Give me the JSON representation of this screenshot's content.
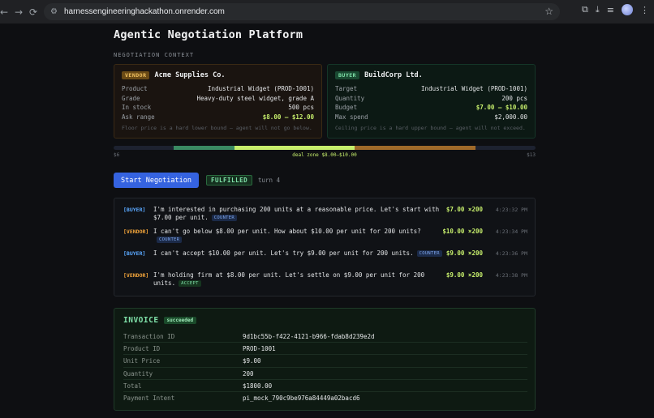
{
  "browser": {
    "url": "harnessengineeringhackathon.onrender.com"
  },
  "page": {
    "title": "Agentic Negotiation Platform",
    "section_label": "NEGOTIATION CONTEXT"
  },
  "vendor": {
    "tag": "VENDOR",
    "name": "Acme Supplies Co.",
    "rows": [
      {
        "k": "Product",
        "v": "Industrial Widget (PROD-1001)"
      },
      {
        "k": "Grade",
        "v": "Heavy-duty steel widget, grade A"
      },
      {
        "k": "In stock",
        "v": "500 pcs"
      },
      {
        "k": "Ask range",
        "v": "$8.00 – $12.00"
      }
    ],
    "note": "Floor price is a hard lower bound — agent will not go below."
  },
  "buyer": {
    "tag": "BUYER",
    "name": "BuildCorp Ltd.",
    "rows": [
      {
        "k": "Target",
        "v": "Industrial Widget (PROD-1001)"
      },
      {
        "k": "Quantity",
        "v": "200 pcs"
      },
      {
        "k": "Budget",
        "v": "$7.00 – $10.00"
      },
      {
        "k": "Max spend",
        "v": "$2,000.00"
      }
    ],
    "note": "Ceiling price is a hard upper bound — agent will not exceed."
  },
  "range": {
    "min_label": "$6",
    "max_label": "$13",
    "zone_label": "deal zone $8.00–$10.00",
    "min": 6,
    "max": 13,
    "buyer_range": [
      7,
      10
    ],
    "vendor_range": [
      8,
      12
    ],
    "zone": [
      8,
      10
    ],
    "colors": {
      "buyer": "#3a8a62",
      "zone": "#c6ee6c",
      "vendor": "#a06a2a"
    }
  },
  "controls": {
    "start_label": "Start Negotiation",
    "status": "FULFILLED",
    "turn": "turn 4"
  },
  "transcript": [
    {
      "role": "[BUYER]",
      "side": "buyer",
      "text": "I'm interested in purchasing 200 units at a reasonable price. Let's start with $7.00 per unit.",
      "badge": "COUNTER",
      "badge_type": "counter",
      "price": "$7.00 ×200",
      "time": "4:23:32 PM"
    },
    {
      "role": "[VENDOR]",
      "side": "vendor",
      "text": "I can't go below $8.00 per unit. How about $10.00 per unit for 200 units?",
      "badge": "COUNTER",
      "badge_type": "counter",
      "price": "$10.00 ×200",
      "time": "4:23:34 PM"
    },
    {
      "role": "[BUYER]",
      "side": "buyer",
      "text": "I can't accept $10.00 per unit. Let's try $9.00 per unit for 200 units.",
      "badge": "COUNTER",
      "badge_type": "counter",
      "price": "$9.00 ×200",
      "time": "4:23:36 PM"
    },
    {
      "role": "[VENDOR]",
      "side": "vendor",
      "text": "I'm holding firm at $8.00 per unit. Let's settle on $9.00 per unit for 200 units.",
      "badge": "ACCEPT",
      "badge_type": "accept",
      "price": "$9.00 ×200",
      "time": "4:23:38 PM"
    }
  ],
  "invoice": {
    "title": "INVOICE",
    "badge": "succeeded",
    "rows": [
      {
        "k": "Transaction ID",
        "v": "9d1bc55b-f422-4121-b966-fdab8d239e2d"
      },
      {
        "k": "Product ID",
        "v": "PROD-1001"
      },
      {
        "k": "Unit Price",
        "v": "$9.00"
      },
      {
        "k": "Quantity",
        "v": "200"
      },
      {
        "k": "Total",
        "v": "$1800.00"
      },
      {
        "k": "Payment Intent",
        "v": "pi_mock_790c9be976a84449a02bacd6"
      }
    ]
  }
}
